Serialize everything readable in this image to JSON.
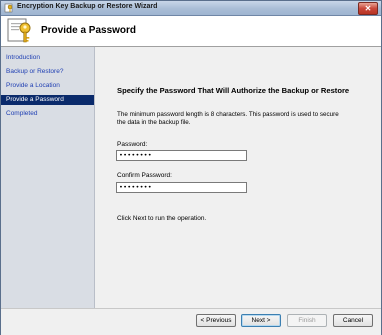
{
  "window": {
    "title": "Encryption Key Backup or Restore Wizard"
  },
  "header": {
    "title": "Provide a Password"
  },
  "sidebar": {
    "items": [
      {
        "label": "Introduction",
        "active": false
      },
      {
        "label": "Backup or Restore?",
        "active": false
      },
      {
        "label": "Provide a Location",
        "active": false
      },
      {
        "label": "Provide a Password",
        "active": true
      },
      {
        "label": "Completed",
        "active": false
      }
    ]
  },
  "main": {
    "heading": "Specify the Password That Will Authorize the Backup or Restore",
    "description": "The minimum password length is 8 characters.  This password is used to secure the data in the backup file.",
    "password_label": "Password:",
    "password_value": "••••••••",
    "confirm_label": "Confirm Password:",
    "confirm_value": "••••••••",
    "note": "Click Next to run the operation."
  },
  "footer": {
    "previous_label": "< Previous",
    "next_label": "Next >",
    "finish_label": "Finish",
    "cancel_label": "Cancel"
  },
  "icons": {
    "window_icon": "key-wizard-icon",
    "header_icon": "key-document-icon",
    "close_icon": "close-icon"
  },
  "colors": {
    "active_nav_bg": "#0a2a6b",
    "nav_link": "#1f3fb3",
    "close_button": "#c9473a"
  }
}
